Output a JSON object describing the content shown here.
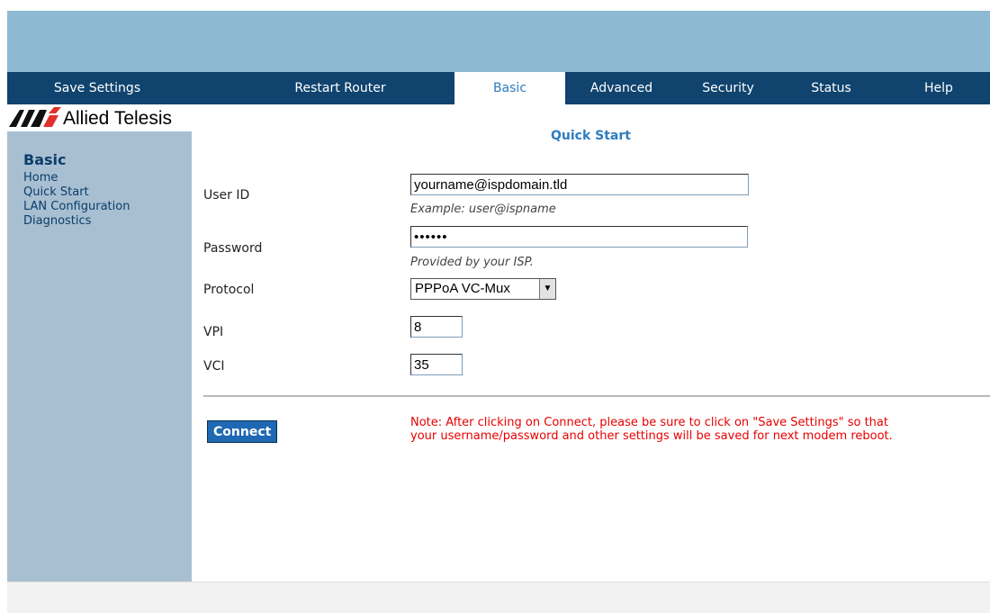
{
  "nav": {
    "items": [
      {
        "label": "Save Settings"
      },
      {
        "label": "Restart Router"
      },
      {
        "label": "Basic"
      },
      {
        "label": "Advanced"
      },
      {
        "label": "Security"
      },
      {
        "label": "Status"
      },
      {
        "label": "Help"
      }
    ],
    "active": "Basic"
  },
  "logo": {
    "text": "Allied Telesis"
  },
  "sidebar": {
    "title": "Basic",
    "items": [
      {
        "label": "Home"
      },
      {
        "label": "Quick Start"
      },
      {
        "label": "LAN Configuration"
      },
      {
        "label": "Diagnostics"
      }
    ]
  },
  "main": {
    "title": "Quick Start",
    "form": {
      "user_id": {
        "label": "User ID",
        "value": "yourname@ispdomain.tld",
        "hint": "Example: user@ispname"
      },
      "password": {
        "label": "Password",
        "value": "••••••",
        "hint": "Provided by your ISP."
      },
      "protocol": {
        "label": "Protocol",
        "value": "PPPoA VC-Mux"
      },
      "vpi": {
        "label": "VPI",
        "value": "8"
      },
      "vci": {
        "label": "VCI",
        "value": "35"
      }
    },
    "connect_label": "Connect",
    "note_line1": "Note: After clicking on Connect, please be sure to click on \"Save Settings\" so that",
    "note_line2": "your username/password and other settings will be saved for next modem reboot."
  },
  "colors": {
    "banner": "#8db9d3",
    "navbar": "#10436e",
    "sidebar": "#a8bfd1",
    "accent": "#2e7cbf",
    "note": "#e80000"
  }
}
